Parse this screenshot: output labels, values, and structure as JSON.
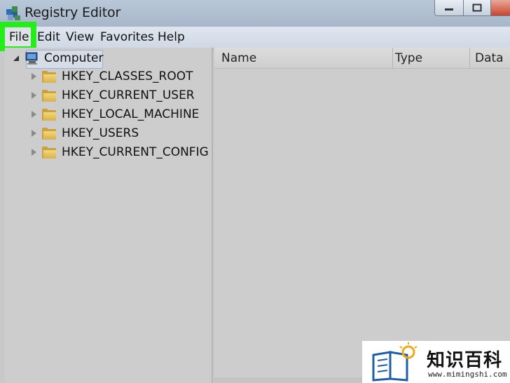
{
  "window": {
    "title": "Registry Editor"
  },
  "menu": {
    "file": "File",
    "edit": "Edit",
    "view": "View",
    "favorites": "Favorites",
    "help": "Help"
  },
  "tree": {
    "root": "Computer",
    "items": [
      {
        "label": "HKEY_CLASSES_ROOT"
      },
      {
        "label": "HKEY_CURRENT_USER"
      },
      {
        "label": "HKEY_LOCAL_MACHINE"
      },
      {
        "label": "HKEY_USERS"
      },
      {
        "label": "HKEY_CURRENT_CONFIG"
      }
    ]
  },
  "columns": {
    "name": "Name",
    "type": "Type",
    "data": "Data"
  },
  "watermark": {
    "text": "知识百科",
    "url": "www.mimingshi.com"
  },
  "colors": {
    "highlight": "#23ee1a",
    "folder": "#e8c462"
  },
  "icons": {
    "app": "registry-editor-icon",
    "folder": "folder-icon",
    "computer": "computer-icon",
    "expander": "triangle-right-icon"
  }
}
